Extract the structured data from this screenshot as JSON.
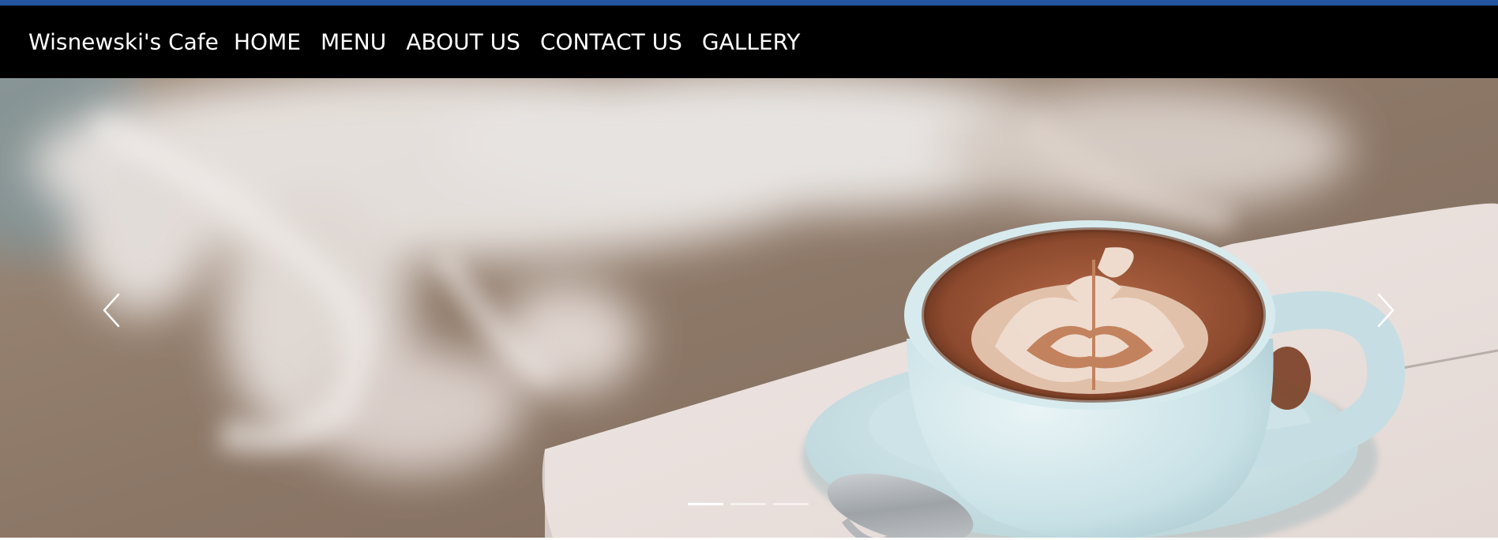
{
  "navbar": {
    "brand": "Wisnewski's Cafe",
    "links": [
      {
        "label": "HOME"
      },
      {
        "label": "MENU"
      },
      {
        "label": "ABOUT US"
      },
      {
        "label": "CONTACT US"
      },
      {
        "label": "GALLERY"
      }
    ]
  },
  "carousel": {
    "slide_count": 3,
    "active_index": 0,
    "prev_icon": "chevron-left-icon",
    "next_icon": "chevron-right-icon"
  },
  "colors": {
    "top_strip": "#2355a0",
    "navbar_bg": "#000000",
    "nav_text": "#ffffff"
  }
}
